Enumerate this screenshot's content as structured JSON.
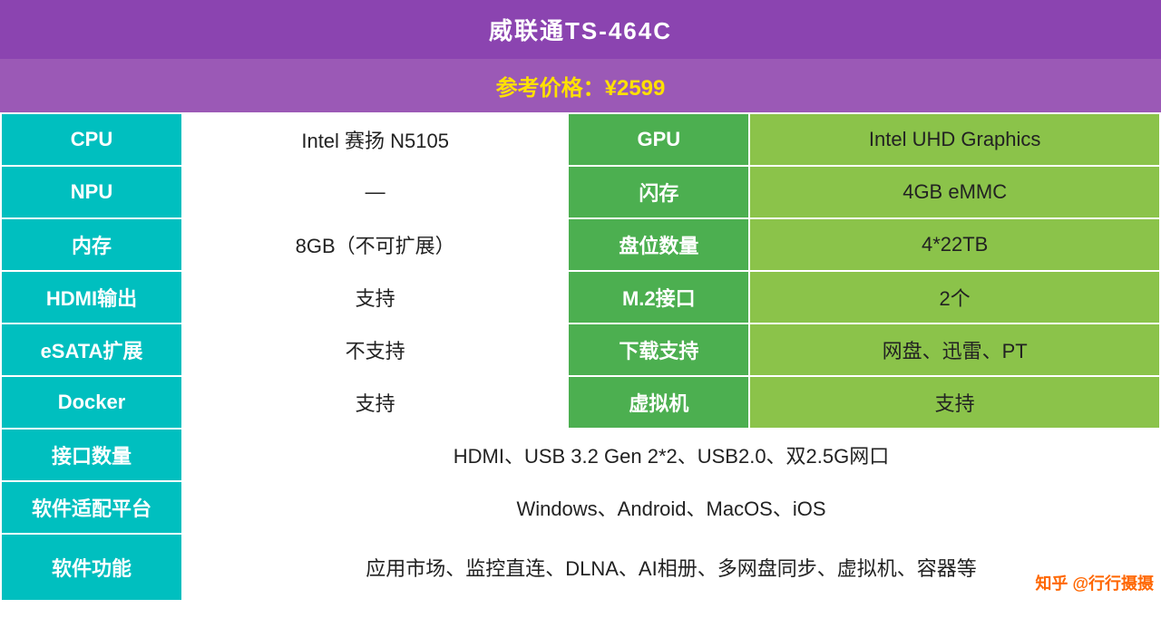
{
  "header": {
    "title": "威联通TS-464C",
    "price_label": "参考价格：¥2599"
  },
  "rows": [
    {
      "type": "four-col",
      "col1_label": "CPU",
      "col1_value": "Intel 赛扬 N5105",
      "col2_label": "GPU",
      "col2_value": "Intel UHD Graphics"
    },
    {
      "type": "four-col",
      "col1_label": "NPU",
      "col1_value": "—",
      "col2_label": "闪存",
      "col2_value": "4GB eMMC"
    },
    {
      "type": "four-col",
      "col1_label": "内存",
      "col1_value": "8GB（不可扩展）",
      "col2_label": "盘位数量",
      "col2_value": "4*22TB"
    },
    {
      "type": "four-col",
      "col1_label": "HDMI输出",
      "col1_value": "支持",
      "col2_label": "M.2接口",
      "col2_value": "2个"
    },
    {
      "type": "four-col",
      "col1_label": "eSATA扩展",
      "col1_value": "不支持",
      "col2_label": "下载支持",
      "col2_value": "网盘、迅雷、PT"
    },
    {
      "type": "four-col",
      "col1_label": "Docker",
      "col1_value": "支持",
      "col2_label": "虚拟机",
      "col2_value": "支持"
    },
    {
      "type": "two-col",
      "label": "接口数量",
      "value": "HDMI、USB 3.2 Gen 2*2、USB2.0、双2.5G网口"
    },
    {
      "type": "two-col",
      "label": "软件适配平台",
      "value": "Windows、Android、MacOS、iOS"
    },
    {
      "type": "two-col",
      "label": "软件功能",
      "value": "应用市场、监控直连、DLNA、AI相册、多网盘同步、虚拟机、容器等"
    }
  ],
  "watermark": "知乎 @行行摄摄"
}
